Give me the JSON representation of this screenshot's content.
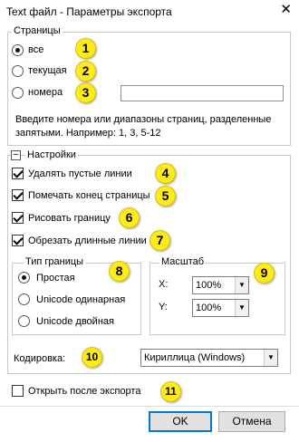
{
  "window": {
    "title": "Text файл - Параметры экспорта",
    "close_glyph": "✕"
  },
  "pages": {
    "legend": "Страницы",
    "opt_all": "все",
    "opt_current": "текущая",
    "opt_numbers": "номера",
    "numbers_value": "",
    "hint": "Введите номера или диапазоны страниц, разделенные запятыми. Например: 1, 3, 5-12"
  },
  "settings": {
    "legend": "Настройки",
    "collapse_glyph": "−",
    "remove_empty": "Удалять пустые линии",
    "mark_page_end": "Помечать конец страницы",
    "draw_border": "Рисовать границу",
    "cut_long": "Обрезать длинные линии"
  },
  "border_type": {
    "legend": "Тип границы",
    "simple": "Простая",
    "unicode_single": "Unicode одинарная",
    "unicode_double": "Unicode двойная"
  },
  "scale": {
    "legend": "Масштаб",
    "x_label": "X:",
    "x_value": "100%",
    "y_label": "Y:",
    "y_value": "100%",
    "arrow": "▼"
  },
  "encoding": {
    "label": "Кодировка:",
    "value": "Кириллица (Windows)"
  },
  "open_after": "Открыть после экспорта",
  "buttons": {
    "ok": "OK",
    "cancel": "Отмена"
  },
  "badges": [
    "1",
    "2",
    "3",
    "4",
    "5",
    "6",
    "7",
    "8",
    "9",
    "10",
    "11"
  ],
  "colors": {
    "badge": "#ffeb1a",
    "accent": "#0078d7"
  }
}
